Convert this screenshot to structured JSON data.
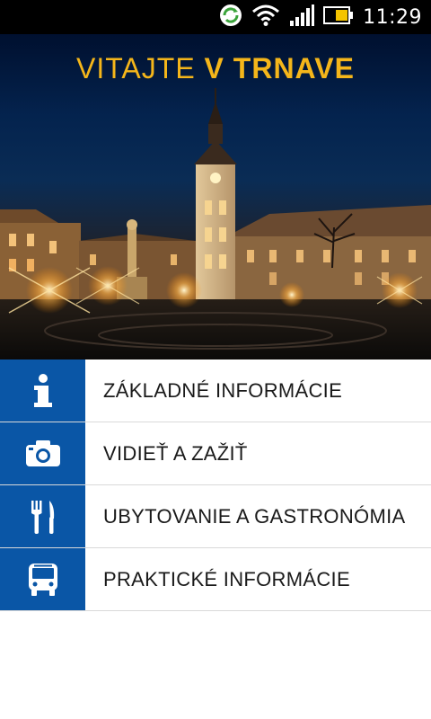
{
  "status_bar": {
    "time": "11:29",
    "icons": [
      "sync-icon",
      "wifi-icon",
      "signal-icon",
      "battery-icon"
    ]
  },
  "hero": {
    "title_light": "VITAJTE ",
    "title_bold": "V TRNAVE"
  },
  "menu": {
    "items": [
      {
        "label": "ZÁKLADNÉ INFORMÁCIE",
        "icon": "info-icon"
      },
      {
        "label": "VIDIEŤ A ZAŽIŤ",
        "icon": "camera-icon"
      },
      {
        "label": "UBYTOVANIE A GASTRONÓMIA",
        "icon": "fork-knife-icon"
      },
      {
        "label": "PRAKTICKÉ INFORMÁCIE",
        "icon": "bus-icon"
      }
    ]
  },
  "colors": {
    "accent_blue": "#0a56a6",
    "title_gold": "#f5b61a"
  }
}
